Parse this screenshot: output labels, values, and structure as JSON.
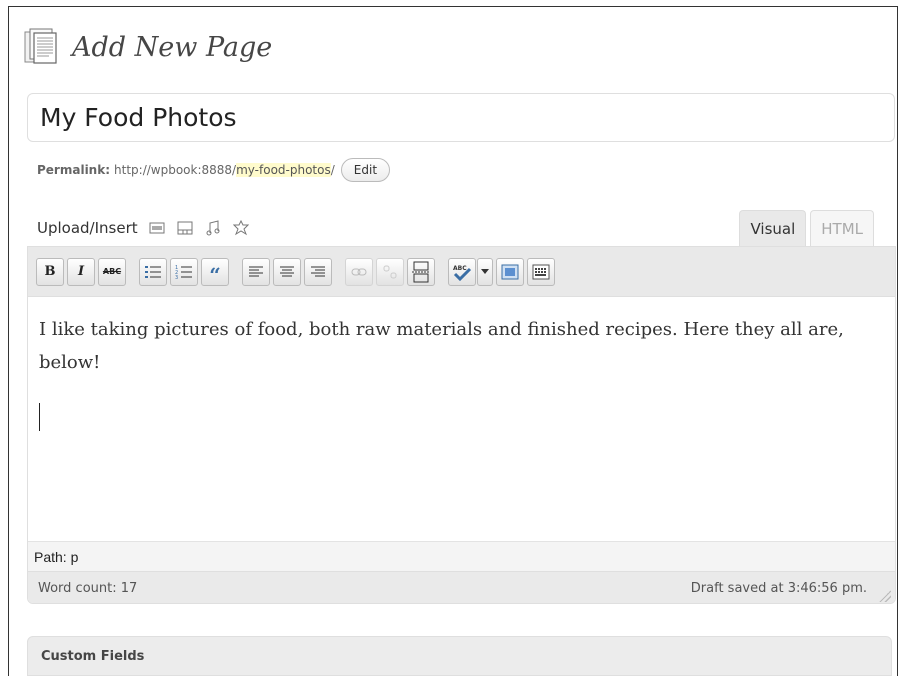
{
  "page": {
    "heading": "Add New Page",
    "heading_icon": "pages-icon"
  },
  "title_field": {
    "value": "My Food Photos"
  },
  "permalink": {
    "label": "Permalink:",
    "base": "http://wpbook:8888/",
    "slug": "my-food-photos",
    "trailing": "/",
    "edit_label": "Edit"
  },
  "media": {
    "label": "Upload/Insert",
    "icons": [
      "image-icon",
      "video-icon",
      "audio-icon",
      "media-icon"
    ]
  },
  "editor_tabs": {
    "visual": "Visual",
    "html": "HTML"
  },
  "toolbar": {
    "bold": "B",
    "italic": "I",
    "strike": "ABC",
    "quote": "“"
  },
  "editor": {
    "content": "I like taking pictures of food, both raw materials and finished recipes. Here they all are, below!",
    "path": "Path: p",
    "word_count": "Word count: 17",
    "draft_status": "Draft saved at 3:46:56 pm."
  },
  "custom_fields": {
    "title": "Custom Fields"
  },
  "colors": {
    "slug_highlight": "#fffbcc",
    "toolbar_bg": "#e9e9e9",
    "heading_text": "#464646"
  }
}
